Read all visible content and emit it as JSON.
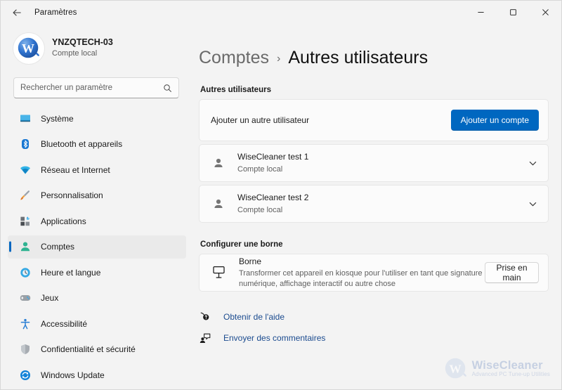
{
  "window": {
    "title": "Paramètres",
    "back_icon": "back-arrow-icon",
    "minimize_label": "—",
    "maximize_label": "▢",
    "close_label": "✕"
  },
  "sidebar": {
    "profile": {
      "name": "YNZQTECH-03",
      "account_type": "Compte local",
      "avatar_letter": "W"
    },
    "search": {
      "placeholder": "Rechercher un paramètre",
      "value": "",
      "icon": "search-icon"
    },
    "items": [
      {
        "label": "Système",
        "icon": "monitor-icon",
        "selected": false
      },
      {
        "label": "Bluetooth et appareils",
        "icon": "bluetooth-icon",
        "selected": false
      },
      {
        "label": "Réseau et Internet",
        "icon": "wifi-icon",
        "selected": false
      },
      {
        "label": "Personnalisation",
        "icon": "paintbrush-icon",
        "selected": false
      },
      {
        "label": "Applications",
        "icon": "apps-icon",
        "selected": false
      },
      {
        "label": "Comptes",
        "icon": "person-icon",
        "selected": true
      },
      {
        "label": "Heure et langue",
        "icon": "clock-globe-icon",
        "selected": false
      },
      {
        "label": "Jeux",
        "icon": "gamepad-icon",
        "selected": false
      },
      {
        "label": "Accessibilité",
        "icon": "accessibility-icon",
        "selected": false
      },
      {
        "label": "Confidentialité et sécurité",
        "icon": "shield-icon",
        "selected": false
      },
      {
        "label": "Windows Update",
        "icon": "update-icon",
        "selected": false
      }
    ]
  },
  "main": {
    "breadcrumb": {
      "parent": "Comptes",
      "separator": "›",
      "current": "Autres utilisateurs"
    },
    "other_users": {
      "section_title": "Autres utilisateurs",
      "add_user": {
        "label": "Ajouter un autre utilisateur",
        "button_label": "Ajouter un compte"
      },
      "users": [
        {
          "name": "WiseCleaner test 1",
          "account_type": "Compte local",
          "icon": "person-icon",
          "expand_icon": "chevron-down-icon"
        },
        {
          "name": "WiseCleaner test 2",
          "account_type": "Compte local",
          "icon": "person-icon",
          "expand_icon": "chevron-down-icon"
        }
      ]
    },
    "kiosk": {
      "section_title": "Configurer une borne",
      "title": "Borne",
      "description": "Transformer cet appareil en kiosque pour l'utiliser en tant que signature numérique, affichage interactif ou autre chose",
      "icon": "kiosk-display-icon",
      "button_label": "Prise en main"
    },
    "links": [
      {
        "label": "Obtenir de l'aide",
        "icon": "help-icon"
      },
      {
        "label": "Envoyer des commentaires",
        "icon": "feedback-icon"
      }
    ]
  },
  "watermark": {
    "title": "WiseCleaner",
    "subtitle": "Advanced PC Tune-up Utilities",
    "logo_letter": "W"
  },
  "colors": {
    "accent": "#0067c0",
    "page_background": "#f3f3f3",
    "card_background": "#fbfbfb",
    "link": "#1b4b8f"
  }
}
